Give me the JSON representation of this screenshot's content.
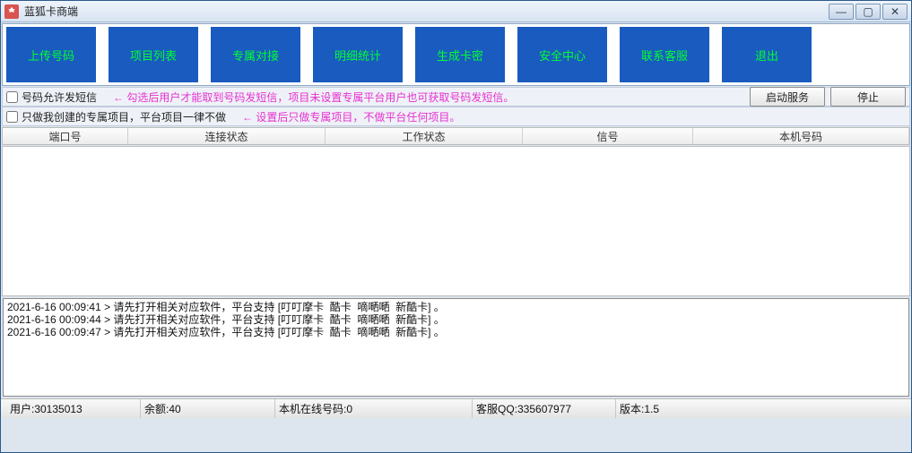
{
  "window": {
    "title": "蓝狐卡商端"
  },
  "toolbar": {
    "items": [
      "上传号码",
      "项目列表",
      "专属对接",
      "明细统计",
      "生成卡密",
      "安全中心",
      "联系客服",
      "退出"
    ]
  },
  "opt1": {
    "label": "号码允许发短信",
    "hint": "← 勾选后用户才能取到号码发短信，项目未设置专属平台用户也可获取号码发短信。"
  },
  "opt2": {
    "label": "只做我创建的专属项目，平台项目一律不做",
    "hint": "← 设置后只做专属项目，不做平台任何项目。"
  },
  "buttons": {
    "start": "启动服务",
    "stop": "停止"
  },
  "grid": {
    "cols": [
      "端口号",
      "连接状态",
      "工作状态",
      "信号",
      "本机号码"
    ]
  },
  "log": [
    "2021-6-16 00:09:41 > 请先打开相关对应软件，平台支持 [叮叮摩卡  酷卡  嘀嗮嗮  新酷卡] 。",
    "2021-6-16 00:09:44 > 请先打开相关对应软件，平台支持 [叮叮摩卡  酷卡  嘀嗮嗮  新酷卡] 。",
    "2021-6-16 00:09:47 > 请先打开相关对应软件，平台支持 [叮叮摩卡  酷卡  嘀嗮嗮  新酷卡] 。"
  ],
  "status": {
    "user": "用户:30135013",
    "balance": "余额:40",
    "online": "本机在线号码:0",
    "qq": "客服QQ:335607977",
    "version": "版本:1.5"
  }
}
